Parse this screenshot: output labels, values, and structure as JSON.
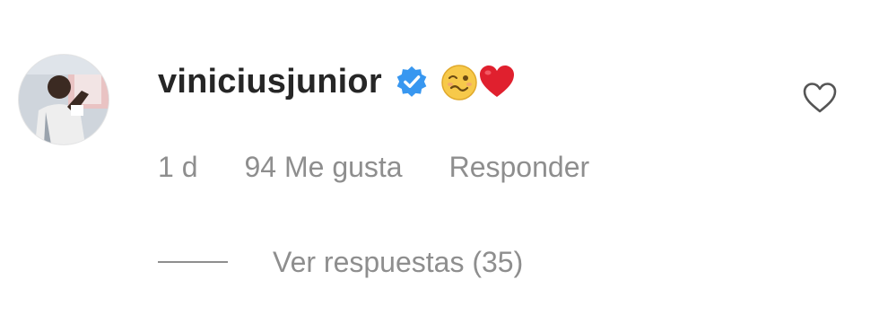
{
  "comment": {
    "username": "viniciusjunior",
    "verified_icon": "verified-badge-icon",
    "emojis": [
      "woozy-face-emoji",
      "red-heart-emoji"
    ],
    "like_icon": "heart-outline-icon",
    "time": "1 d",
    "likes": "94 Me gusta",
    "reply": "Responder",
    "view_replies": "Ver respuestas (35)"
  },
  "colors": {
    "text": "#262626",
    "secondary": "#8e8e8e",
    "verified": "#3897f0",
    "heart_red": "#e0202e"
  }
}
